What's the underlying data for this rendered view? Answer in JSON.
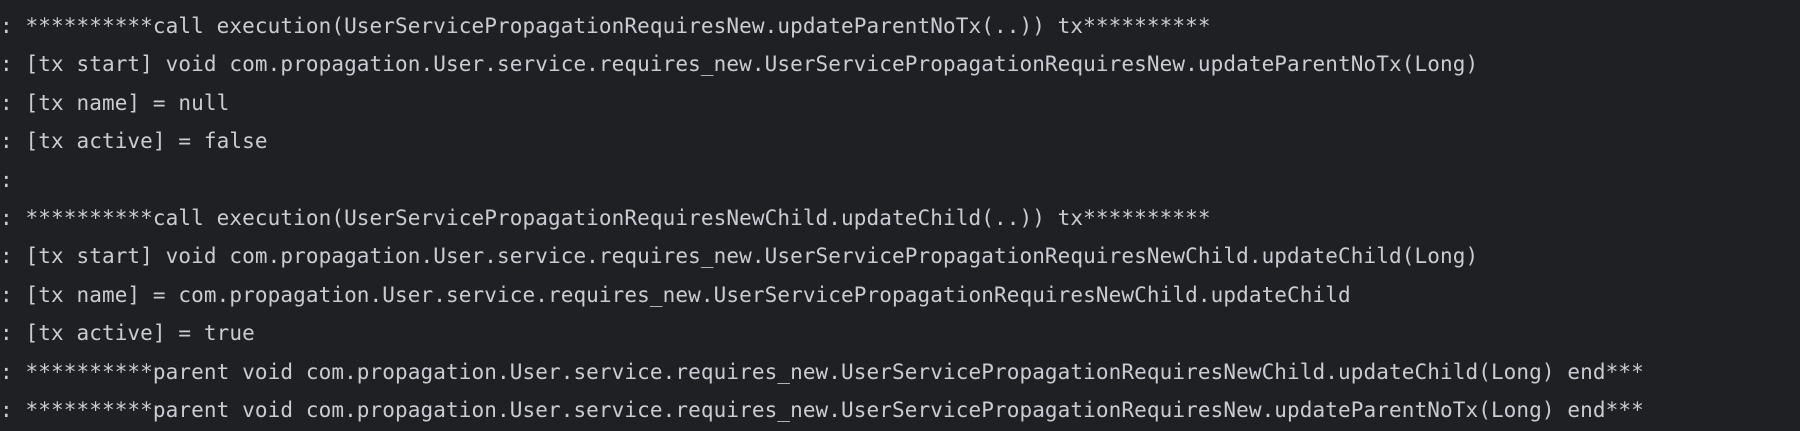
{
  "console": {
    "lines": [
      ": **********call execution(UserServicePropagationRequiresNew.updateParentNoTx(..)) tx**********",
      ": [tx start] void com.propagation.User.service.requires_new.UserServicePropagationRequiresNew.updateParentNoTx(Long)",
      ": [tx name] = null",
      ": [tx active] = false",
      ":",
      ": **********call execution(UserServicePropagationRequiresNewChild.updateChild(..)) tx**********",
      ": [tx start] void com.propagation.User.service.requires_new.UserServicePropagationRequiresNewChild.updateChild(Long)",
      ": [tx name] = com.propagation.User.service.requires_new.UserServicePropagationRequiresNewChild.updateChild",
      ": [tx active] = true",
      ": **********parent void com.propagation.User.service.requires_new.UserServicePropagationRequiresNewChild.updateChild(Long) end***",
      ": **********parent void com.propagation.User.service.requires_new.UserServicePropagationRequiresNew.updateParentNoTx(Long) end***"
    ]
  }
}
